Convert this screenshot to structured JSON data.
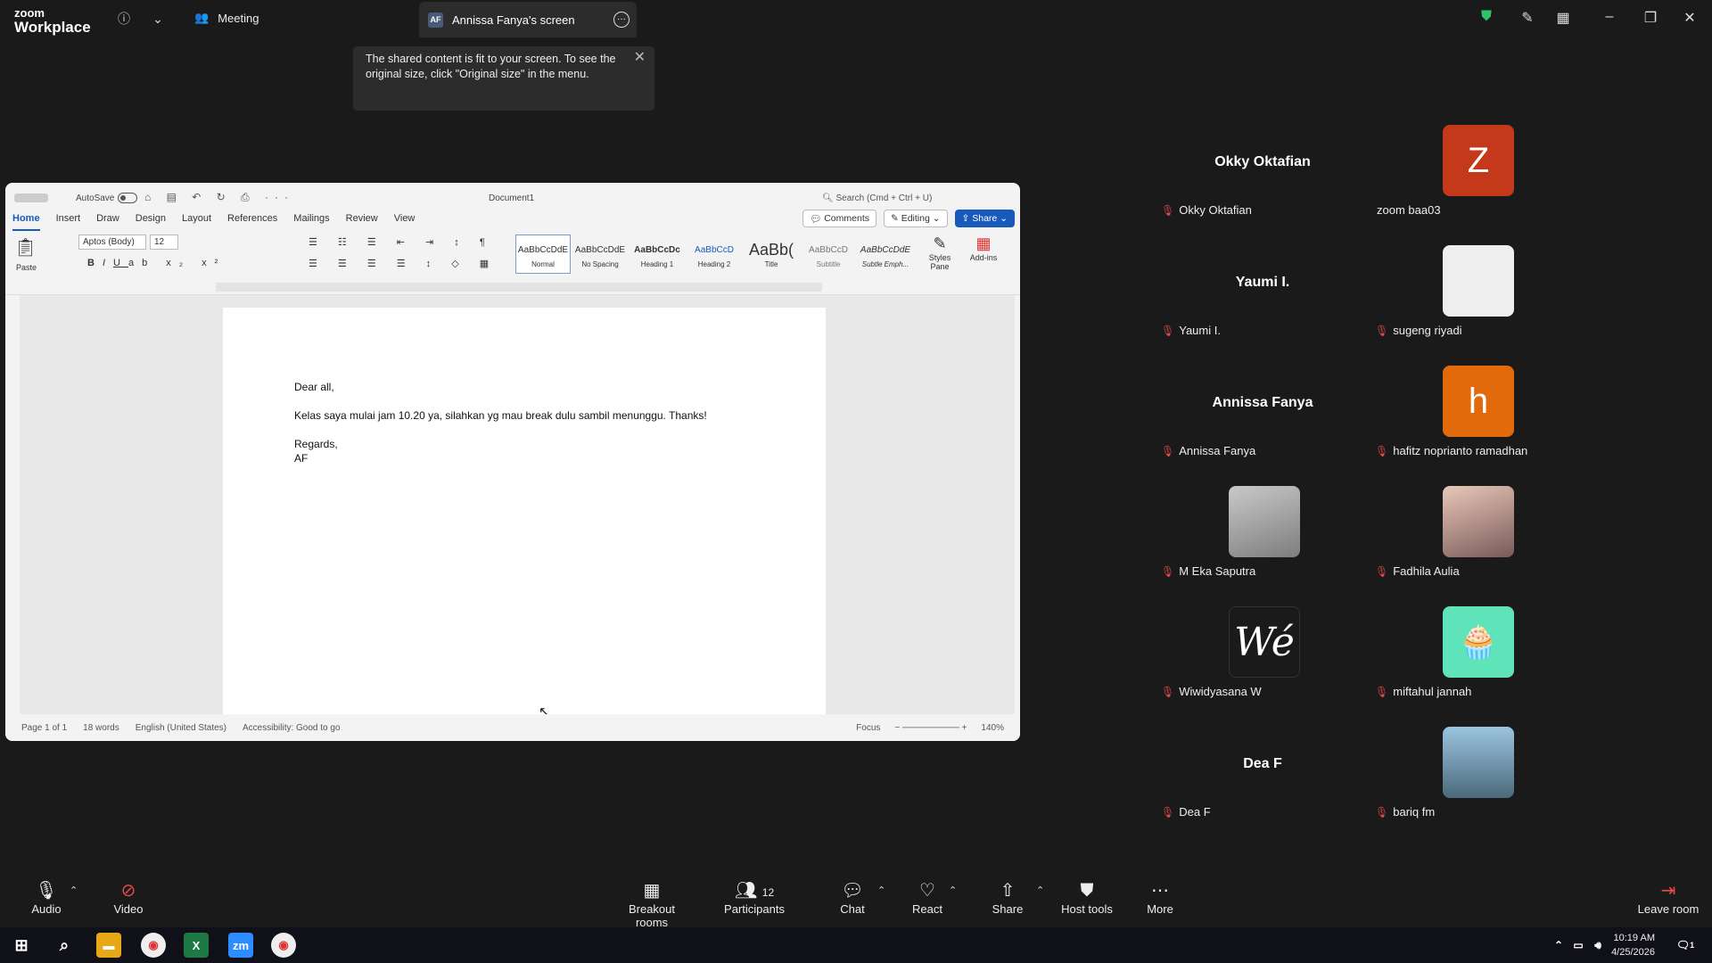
{
  "zoom": {
    "brand_top": "zoom",
    "brand_bottom": "Workplace",
    "meeting_label": "Meeting",
    "share_tab_initials": "AF",
    "share_tab_label": "Annissa Fanya's screen",
    "toast_text": "The shared content is fit to your screen. To see the original size, click \"Original size\" in the menu."
  },
  "word": {
    "autosave": "AutoSave",
    "doc_title": "Document1",
    "search_placeholder": "Search (Cmd + Ctrl + U)",
    "menus": [
      "Home",
      "Insert",
      "Draw",
      "Design",
      "Layout",
      "References",
      "Mailings",
      "Review",
      "View"
    ],
    "comments": "Comments",
    "editing": "Editing",
    "share": "Share",
    "paste": "Paste",
    "font": "Aptos (Body)",
    "size": "12",
    "styles": [
      {
        "sample": "AaBbCcDdE",
        "name": "Normal"
      },
      {
        "sample": "AaBbCcDdE",
        "name": "No Spacing"
      },
      {
        "sample": "AaBbCcDc",
        "name": "Heading 1"
      },
      {
        "sample": "AaBbCcD",
        "name": "Heading 2"
      },
      {
        "sample": "AaBb(",
        "name": "Title"
      },
      {
        "sample": "AaBbCcD",
        "name": "Subtitle"
      },
      {
        "sample": "AaBbCcDdE",
        "name": "Subtle Emph..."
      }
    ],
    "styles_pane": "Styles Pane",
    "addins": "Add-ins",
    "body": {
      "greeting": "Dear all,",
      "message": "Kelas saya mulai jam 10.20 ya, silahkan yg mau break dulu sambil menunggu. Thanks!",
      "regards": "Regards,",
      "sign": "AF"
    },
    "status": {
      "page": "Page 1 of 1",
      "words": "18 words",
      "language": "English (United States)",
      "accessibility": "Accessibility: Good to go",
      "focus": "Focus",
      "zoom": "140%"
    }
  },
  "participants": [
    {
      "name": "Okky Oktafian",
      "display": "Okky Oktafian",
      "avatar": "name"
    },
    {
      "name": "zoom baa03",
      "avatar": "Z",
      "color": "#c5391b"
    },
    {
      "name": "Yaumi I.",
      "display": "Yaumi I.",
      "avatar": "name"
    },
    {
      "name": "sugeng riyadi",
      "avatar": "photo"
    },
    {
      "name": "Annissa Fanya",
      "display": "Annissa Fanya",
      "avatar": "name"
    },
    {
      "name": "hafitz noprianto ramadhan",
      "avatar": "h",
      "color": "#e26a0a"
    },
    {
      "name": "M Eka Saputra",
      "avatar": "photo"
    },
    {
      "name": "Fadhila Aulia",
      "avatar": "photo"
    },
    {
      "name": "Wiwidyasana W",
      "avatar": "Wé",
      "color": "#1a1a1a"
    },
    {
      "name": "miftahul jannah",
      "avatar": "photo"
    },
    {
      "name": "Dea F",
      "display": "Dea F",
      "avatar": "name"
    },
    {
      "name": "bariq fm",
      "avatar": "photo"
    }
  ],
  "toolbar": {
    "audio": "Audio",
    "video": "Video",
    "breakout": "Breakout rooms",
    "participants": "Participants",
    "participants_count": "12",
    "chat": "Chat",
    "react": "React",
    "share": "Share",
    "host_tools": "Host tools",
    "more": "More",
    "leave": "Leave room"
  },
  "taskbar": {
    "time": "10:19 AM",
    "date": "4/25/2026",
    "notif": "1"
  }
}
